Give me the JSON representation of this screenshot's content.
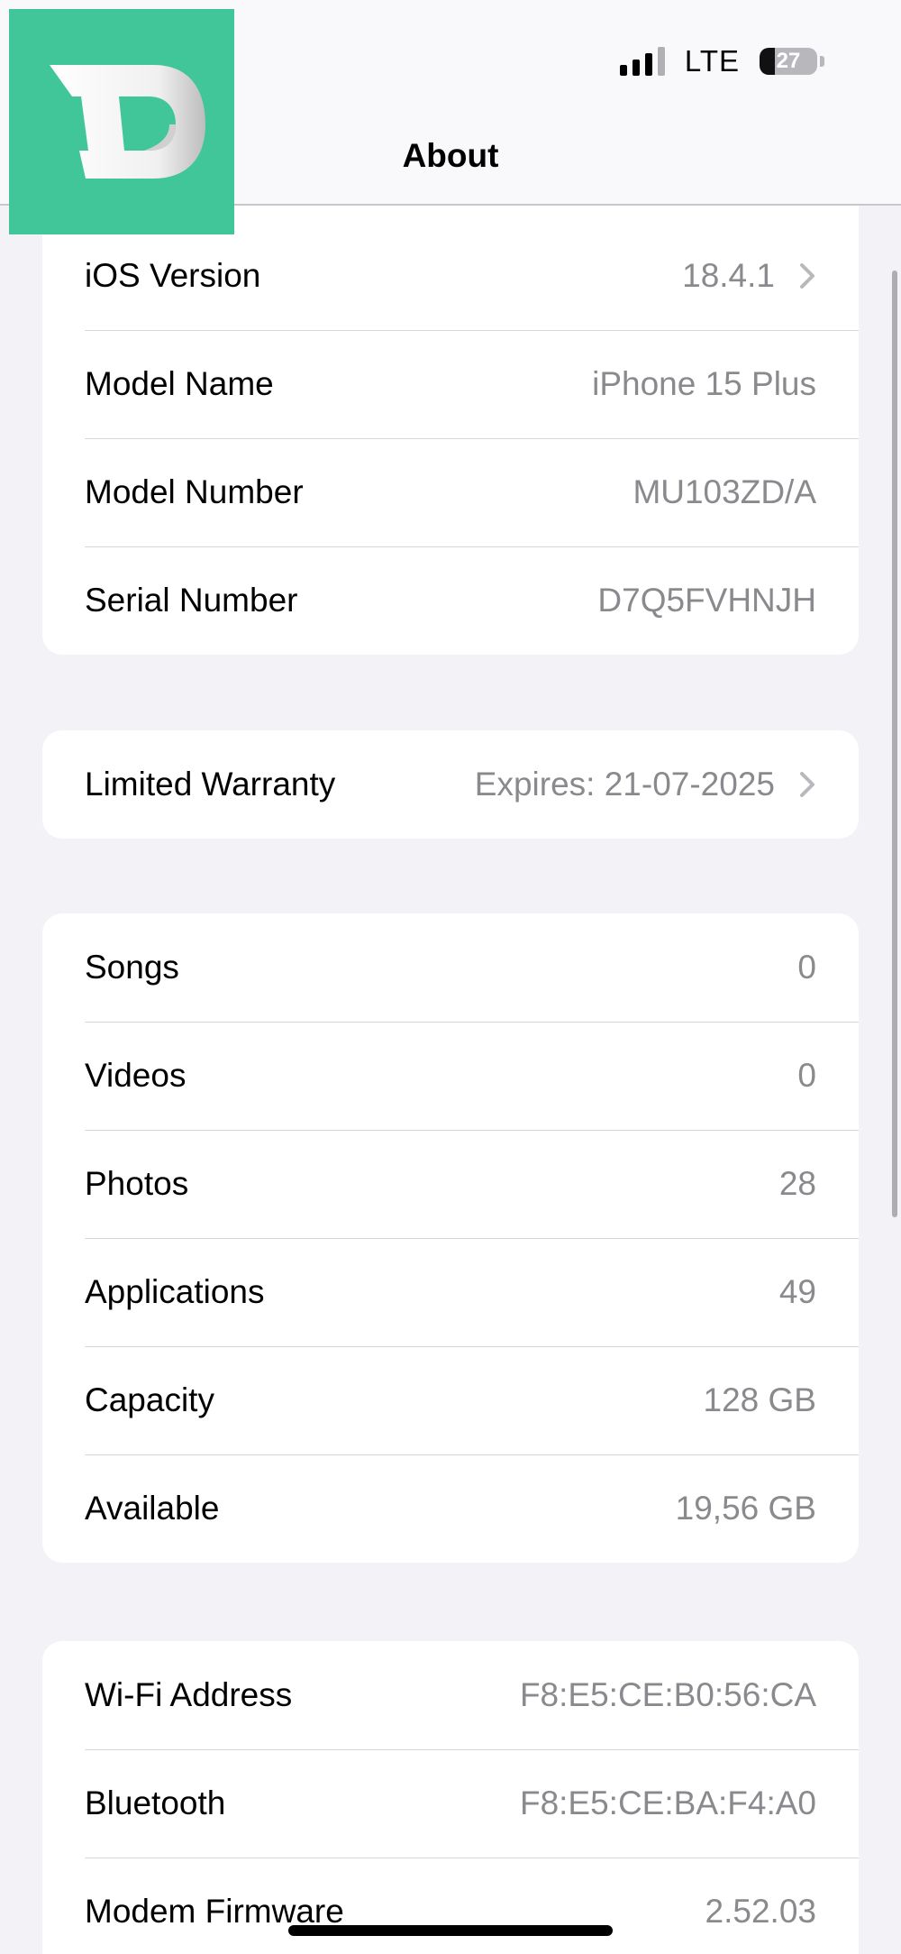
{
  "status_bar": {
    "network": "LTE",
    "battery": "27",
    "battery_level": 0.27
  },
  "header": {
    "title": "About"
  },
  "logo": {
    "letter": "D",
    "color": "#40c698"
  },
  "sections": {
    "device": [
      {
        "label": "iOS Version",
        "value": "18.4.1",
        "chevron": true
      },
      {
        "label": "Model Name",
        "value": "iPhone 15 Plus",
        "chevron": false
      },
      {
        "label": "Model Number",
        "value": "MU103ZD/A",
        "chevron": false
      },
      {
        "label": "Serial Number",
        "value": "D7Q5FVHNJH",
        "chevron": false
      }
    ],
    "warranty": [
      {
        "label": "Limited Warranty",
        "value": "Expires: 21-07-2025",
        "chevron": true
      }
    ],
    "media": [
      {
        "label": "Songs",
        "value": "0"
      },
      {
        "label": "Videos",
        "value": "0"
      },
      {
        "label": "Photos",
        "value": "28"
      },
      {
        "label": "Applications",
        "value": "49"
      },
      {
        "label": "Capacity",
        "value": "128 GB"
      },
      {
        "label": "Available",
        "value": "19,56 GB"
      }
    ],
    "network": [
      {
        "label": "Wi-Fi Address",
        "value": "F8:E5:CE:B0:56:CA"
      },
      {
        "label": "Bluetooth",
        "value": "F8:E5:CE:BA:F4:A0"
      },
      {
        "label": "Modem Firmware",
        "value": "2.52.03"
      }
    ]
  },
  "colors": {
    "background": "#f2f2f7",
    "value_text": "#8a8a8e",
    "logo_green": "#40c698"
  }
}
